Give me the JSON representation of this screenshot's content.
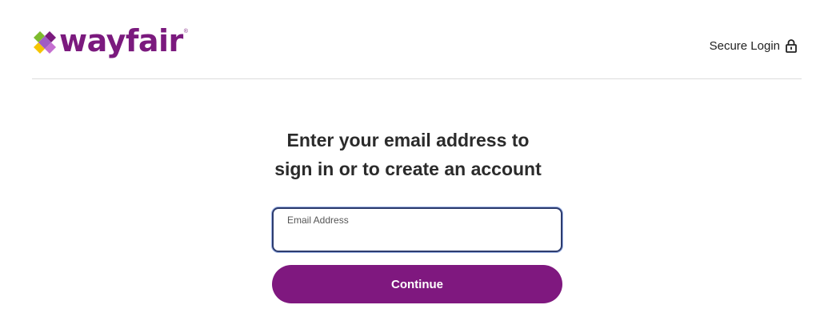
{
  "header": {
    "logo_text": "wayfair",
    "logo_registered": "®",
    "secure_login_label": "Secure Login"
  },
  "main": {
    "heading_line1": "Enter your email address to",
    "heading_line2": "sign in or to create an account",
    "email_field": {
      "label": "Email Address",
      "value": "",
      "placeholder": ""
    },
    "continue_label": "Continue"
  },
  "colors": {
    "brand_purple": "#7f187f",
    "logo_purple": "#7b1a7e",
    "field_border": "#2d3c6e",
    "divider": "#dcdcdc"
  },
  "icons": {
    "logo_mark": "wayfair-pinwheel-icon",
    "secure": "lock-icon"
  }
}
